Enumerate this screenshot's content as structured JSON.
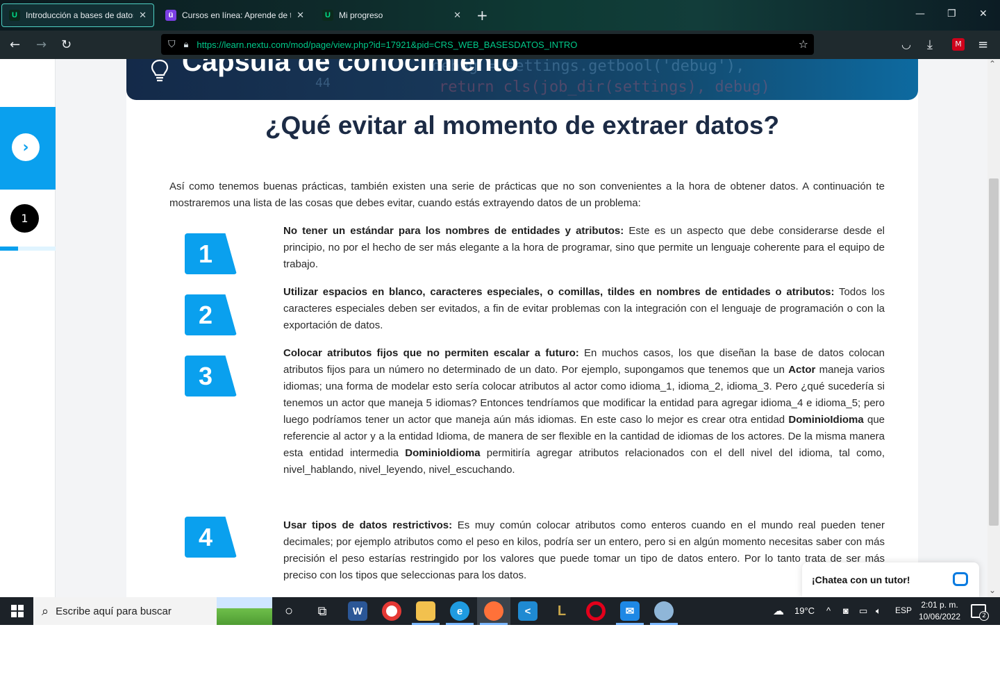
{
  "browser": {
    "tabs": [
      {
        "title": "Introducción a bases de datos",
        "active": true,
        "favicon": "nextu-icon"
      },
      {
        "title": "Cursos en línea: Aprende de todo",
        "active": false,
        "favicon": "udemy-icon"
      },
      {
        "title": "Mi progreso",
        "active": false,
        "favicon": "nextu-icon"
      }
    ],
    "new_tab": "+",
    "url": "https://learn.nextu.com/mod/page/view.php?id=17921&pid=CRS_WEB_BASESDATOS_INTRO",
    "accent": "#00c98a"
  },
  "sidebar": {
    "step_number": "1",
    "progress_fraction": 0.32
  },
  "banner": {
    "title": "Cápsula de conocimiento",
    "code_line_1": "debug = settings.getbool('debug'),",
    "code_line_2": "return cls(job_dir(settings), debug)",
    "code_number": "44"
  },
  "article": {
    "heading": "¿Qué evitar al momento de extraer datos?",
    "intro": "Así como tenemos buenas prácticas, también existen una serie de prácticas que no son convenientes a la hora de obtener datos. A continuación te mostraremos una lista de las cosas que debes evitar, cuando estás extrayendo datos de un problema:",
    "items": [
      {
        "number": "1",
        "title": "No tener un estándar para los nombres de entidades y atributos:",
        "body": " Este es un aspecto que debe considerarse desde el principio, no por el hecho de ser más elegante a la hora de programar, sino que permite un lenguaje coherente para el equipo de trabajo."
      },
      {
        "number": "2",
        "title": "Utilizar espacios en blanco, caracteres especiales, o comillas, tildes en nombres de entidades o atributos:",
        "body": " Todos los caracteres especiales deben ser evitados, a fin de evitar problemas con la integración con el lenguaje de programación o con la exportación de datos."
      },
      {
        "number": "3",
        "title": "Colocar atributos fijos que no permiten escalar a futuro:",
        "body_a": " En muchos casos, los que diseñan la base de datos colocan atributos fijos para un número no determinado de un dato. Por ejemplo, supongamos que tenemos que un ",
        "bold_a": "Actor",
        "body_b": " maneja varios idiomas; una forma de modelar esto sería colocar atributos al actor como idioma_1, idioma_2, idioma_3. Pero ¿qué sucedería si tenemos un actor que maneja 5 idiomas? Entonces tendríamos que modificar la entidad para agregar idioma_4 e idioma_5; pero luego podríamos tener un actor que maneja aún más idiomas. En este caso lo mejor es crear otra entidad ",
        "bold_b": "DominioIdioma",
        "body_c": " que referencie al actor y a la entidad Idioma, de manera de ser flexible en la cantidad de idiomas de los actores. De la misma manera esta entidad intermedia ",
        "bold_c": "DominioIdioma",
        "body_d": " permitiría agregar atributos relacionados con el dell nivel del idioma, tal como, nivel_hablando, nivel_leyendo, nivel_escuchando."
      },
      {
        "number": "4",
        "title": "Usar tipos de datos restrictivos:",
        "body": " Es muy común colocar atributos como enteros cuando en el mundo real pueden tener decimales; por ejemplo atributos como el peso en kilos, podría ser un entero, pero si en algún momento necesitas saber con más precisión el peso estarías restringido por los valores que puede tomar un tipo de datos entero. Por lo tanto trata de ser más preciso con los tipos que seleccionas para los datos."
      }
    ],
    "badge_color": "#0aa0ee",
    "heading_color": "#1c2b45"
  },
  "chat": {
    "label": "¡Chatea con un tutor!"
  },
  "taskbar": {
    "search_placeholder": "Escribe aquí para buscar",
    "weather": "19°C",
    "language": "ESP",
    "time": "2:01 p. m.",
    "date": "10/06/2022",
    "notifications": "2"
  }
}
